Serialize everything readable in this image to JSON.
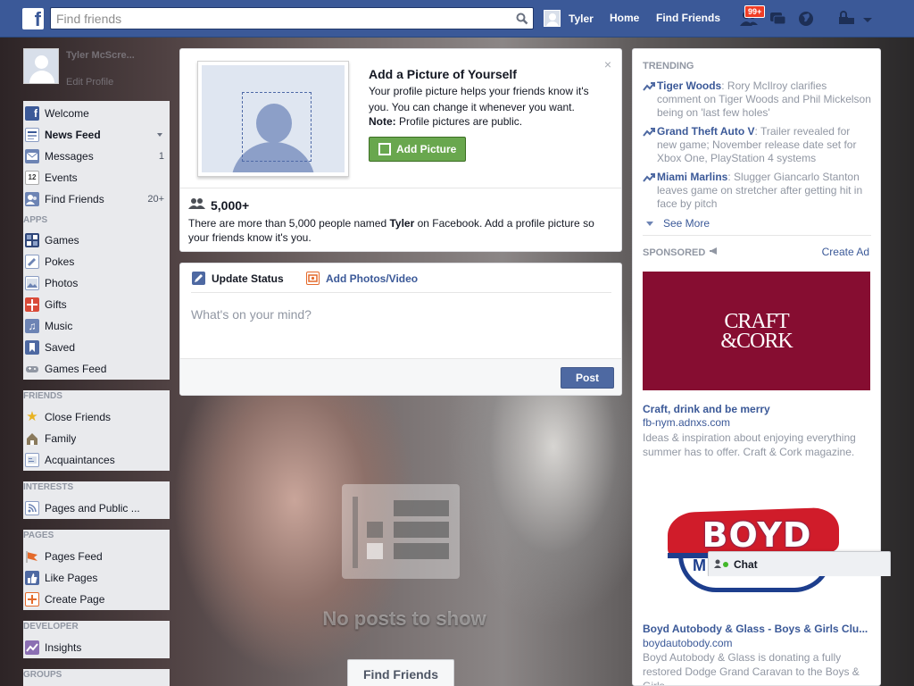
{
  "topbar": {
    "logo": "f",
    "search_placeholder": "Find friends",
    "user_name": "Tyler",
    "home": "Home",
    "find_friends": "Find Friends",
    "notif_badge": "99+"
  },
  "profile_mini": {
    "name": "Tyler McScre...",
    "edit": "Edit Profile"
  },
  "nav_main": [
    {
      "label": "Welcome",
      "icon": "facebook-icon",
      "count": ""
    },
    {
      "label": "News Feed",
      "icon": "news-feed-icon",
      "count": ""
    },
    {
      "label": "Messages",
      "icon": "messages-icon",
      "count": "1"
    },
    {
      "label": "Events",
      "icon": "calendar-icon",
      "count": ""
    },
    {
      "label": "Find Friends",
      "icon": "find-friends-icon",
      "count": "20+"
    }
  ],
  "sections": {
    "apps": "APPS",
    "friends": "FRIENDS",
    "interests": "INTERESTS",
    "pages": "PAGES",
    "developer": "DEVELOPER",
    "groups": "GROUPS"
  },
  "nav_apps": [
    {
      "label": "Games",
      "icon": "games-icon"
    },
    {
      "label": "Pokes",
      "icon": "pokes-icon"
    },
    {
      "label": "Photos",
      "icon": "photos-icon"
    },
    {
      "label": "Gifts",
      "icon": "gifts-icon"
    },
    {
      "label": "Music",
      "icon": "music-icon"
    },
    {
      "label": "Saved",
      "icon": "saved-icon"
    },
    {
      "label": "Games Feed",
      "icon": "games-feed-icon"
    }
  ],
  "nav_friends": [
    {
      "label": "Close Friends",
      "icon": "star-icon"
    },
    {
      "label": "Family",
      "icon": "family-icon"
    },
    {
      "label": "Acquaintances",
      "icon": "acquaintances-icon"
    }
  ],
  "nav_interests": [
    {
      "label": "Pages and Public ...",
      "icon": "rss-icon"
    }
  ],
  "nav_pages": [
    {
      "label": "Pages Feed",
      "icon": "pages-feed-icon"
    },
    {
      "label": "Like Pages",
      "icon": "like-icon"
    },
    {
      "label": "Create Page",
      "icon": "create-page-icon"
    }
  ],
  "nav_developer": [
    {
      "label": "Insights",
      "icon": "insights-icon"
    }
  ],
  "profile_prompt": {
    "title": "Add a Picture of Yourself",
    "desc": "Your profile picture helps your friends know it's you. You can change it whenever you want.",
    "note_label": "Note:",
    "note_text": " Profile pictures are public.",
    "button": "Add Picture",
    "close": "×",
    "count": "5,000+",
    "more_pre": "There are more than 5,000 people named ",
    "more_name": "Tyler",
    "more_post": " on Facebook. Add a profile picture so your friends know it's you."
  },
  "composer": {
    "tab_status": "Update Status",
    "tab_photos": "Add Photos/Video",
    "placeholder": "What's on your mind?",
    "post": "Post"
  },
  "feed": {
    "empty_text": "No posts to show",
    "find_friends": "Find Friends"
  },
  "trending": {
    "heading": "TRENDING",
    "items": [
      {
        "topic": "Tiger Woods",
        "text": ": Rory McIlroy clarifies comment on Tiger Woods and Phil Mickelson being on 'last few holes'"
      },
      {
        "topic": "Grand Theft Auto V",
        "text": ": Trailer revealed for new game; November release date set for Xbox One, PlayStation 4 systems"
      },
      {
        "topic": "Miami Marlins",
        "text": ": Slugger Giancarlo Stanton leaves game on stretcher after getting hit in face by pitch"
      }
    ],
    "see_more": "See More"
  },
  "sponsored": {
    "heading": "SPONSORED",
    "create_ad": "Create Ad",
    "ads": [
      {
        "img_line1": "CRAFT",
        "img_line2": "&CORK",
        "title": "Craft, drink and be merry",
        "url": "fb-nym.adnxs.com",
        "desc": "Ideas & inspiration about enjoying everything summer has to offer. Craft & Cork magazine."
      },
      {
        "img_text": "BOYD",
        "img_m": "M",
        "title": "Boyd Autobody & Glass - Boys & Girls Clu...",
        "url": "boydautobody.com",
        "desc": "Boyd Autobody & Glass is donating a fully restored Dodge Grand Caravan to the Boys & Girls"
      }
    ]
  },
  "chat": {
    "label": "Chat"
  },
  "colors": {
    "brand_blue": "#3b5998",
    "green_button": "#69a74e",
    "ad_red": "#860d31"
  }
}
